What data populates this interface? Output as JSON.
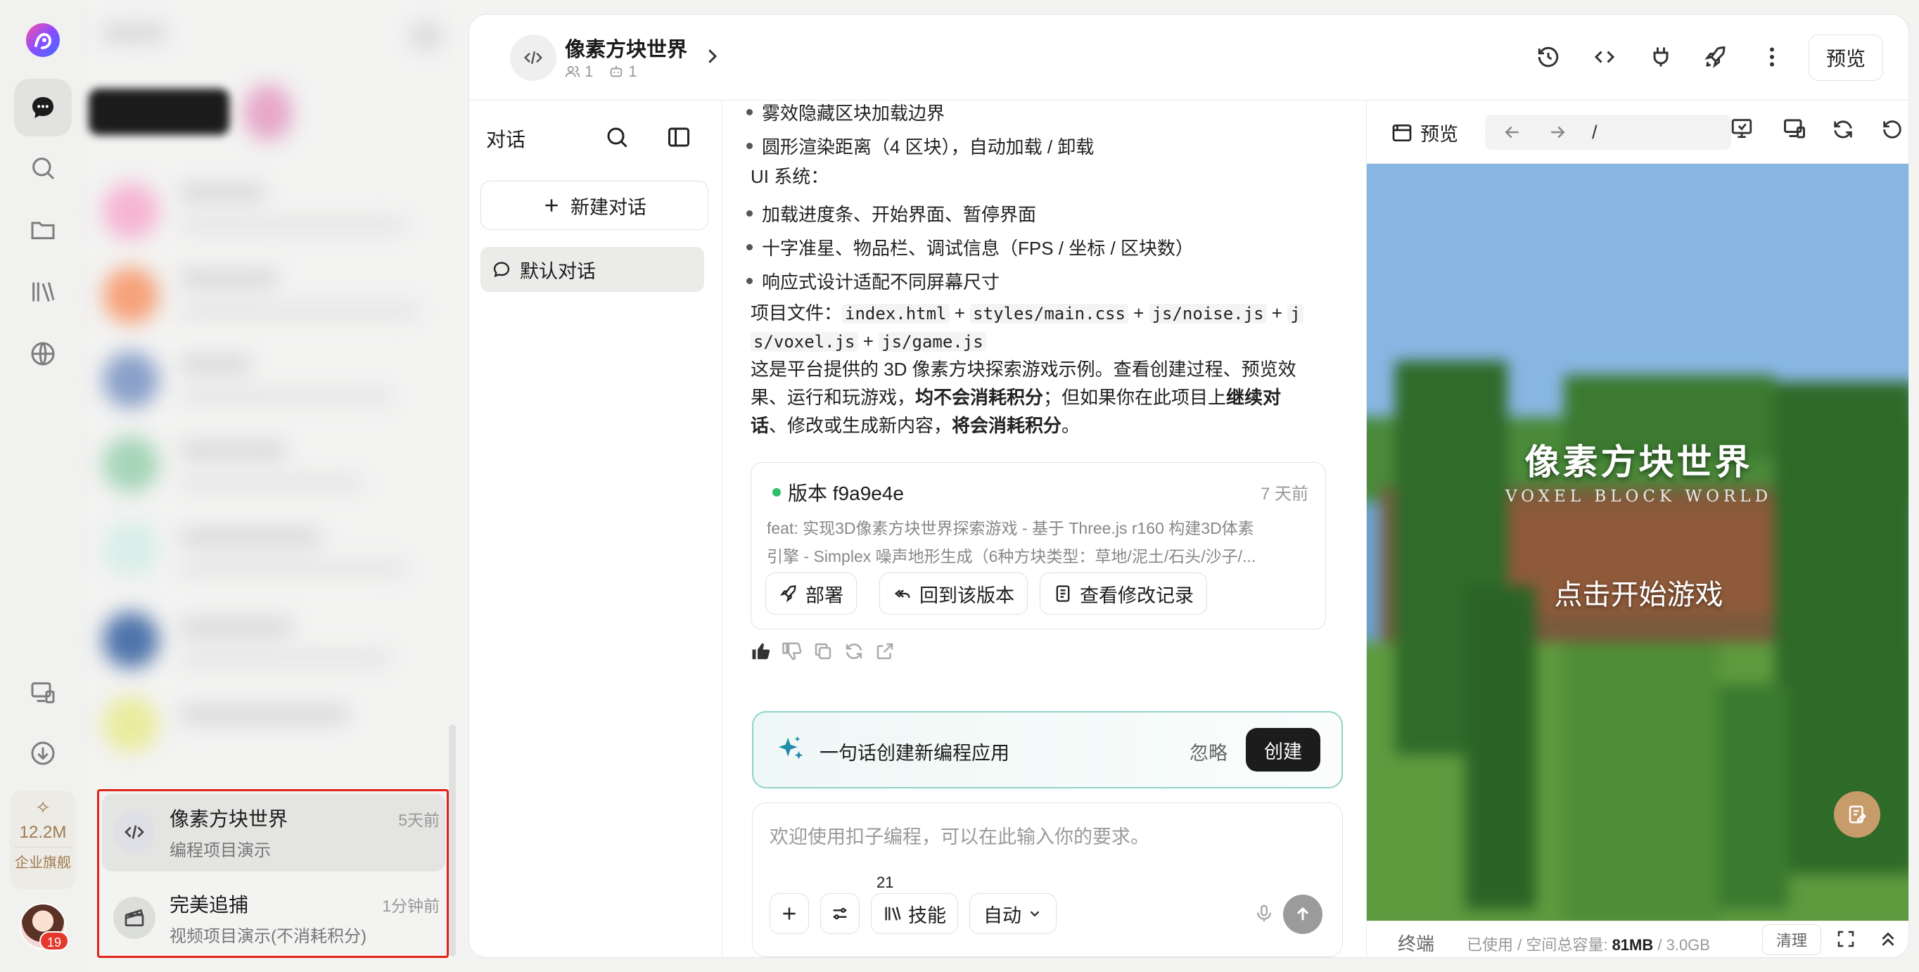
{
  "app": {
    "accent": "#1c1c1c",
    "suggest_border": "#8fd3c7",
    "highlight_color": "#e2231a"
  },
  "rail": {
    "credits_value": "12.2M",
    "credits_tier": "企业旗舰",
    "notification_count": "19",
    "icons": [
      "logo-icon",
      "chat-icon",
      "search-icon",
      "folder-icon",
      "library-icon",
      "globe-icon",
      "devices-icon",
      "download-icon"
    ]
  },
  "projects": [
    {
      "title": "像素方块世界",
      "subtitle": "编程项目演示",
      "time": "5天前"
    },
    {
      "title": "完美追捕",
      "subtitle": "视频项目演示(不消耗积分)",
      "time": "1分钟前"
    }
  ],
  "header": {
    "project_name": "像素方块世界",
    "members": "1",
    "bots": "1",
    "preview_label": "预览"
  },
  "conversations": {
    "title": "对话",
    "new_chat": "新建对话",
    "items": [
      "默认对话"
    ]
  },
  "chat": {
    "bullets_top": [
      "雾效隐藏区块加载边界",
      "圆形渲染距离（4 区块），自动加载 / 卸载"
    ],
    "ui_heading": "UI 系统：",
    "bullets_ui": [
      "加载进度条、开始界面、暂停界面",
      "十字准星、物品栏、调试信息（FPS / 坐标 / 区块数）",
      "响应式设计适配不同屏幕尺寸"
    ],
    "files_label": "项目文件：",
    "file1": "index.html",
    "file2": "styles/main.css",
    "file3": "js/noise.js",
    "file4_part1": "j",
    "file4_part2": "s/voxel.js",
    "file5": "js/game.js",
    "plus": "+",
    "note_line1": "这是平台提供的 3D 像素方块探索游戏示例。查看创建过程、预览效",
    "note_line2_a": "果、运行和玩游戏，",
    "note_line2_b": "均不会消耗积分",
    "note_line2_c": "；但如果你在此项目上",
    "note_line2_d": "继续对",
    "note_line3_a": "话",
    "note_line3_b": "、修改或生成新内容，",
    "note_line3_c": "将会消耗积分",
    "note_line3_d": "。",
    "version": {
      "title": "版本 f9a9e4e",
      "time": "7 天前",
      "desc1": "feat: 实现3D像素方块世界探索游戏 - 基于 Three.js r160 构建3D体素",
      "desc2": "引擎 - Simplex 噪声地形生成（6种方块类型：草地/泥土/石头/沙子/...",
      "buttons": [
        "部署",
        "回到该版本",
        "查看修改记录"
      ]
    },
    "suggest": {
      "text": "一句话创建新编程应用",
      "ignore": "忽略",
      "create": "创建"
    },
    "input": {
      "placeholder": "欢迎使用扣子编程，可以在此输入你的要求。",
      "skill_label": "技能",
      "skill_count": "21",
      "mode": "自动"
    }
  },
  "preview": {
    "label": "预览",
    "path": "/",
    "game_title": "像素方块世界",
    "game_subtitle": "VOXEL BLOCK WORLD",
    "game_start": "点击开始游戏",
    "terminal": "终端",
    "usage_label": "已使用 / 空间总容量: ",
    "usage_used": "81MB",
    "usage_sep": " / ",
    "usage_total": "3.0GB",
    "clear": "清理"
  }
}
